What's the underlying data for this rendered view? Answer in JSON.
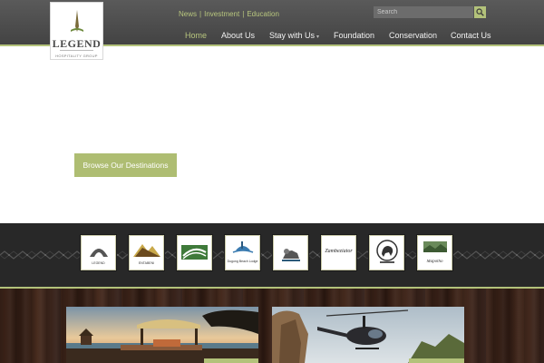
{
  "logo": {
    "brand": "LEGEND",
    "subtitle": "HOSPITALITY GROUP"
  },
  "utility_links": [
    "News",
    "Investment",
    "Education"
  ],
  "utility_separator": "|",
  "search": {
    "placeholder": "Search"
  },
  "nav": {
    "items": [
      {
        "label": "Home",
        "active": true
      },
      {
        "label": "About Us"
      },
      {
        "label": "Stay with Us",
        "dropdown": true
      },
      {
        "label": "Foundation"
      },
      {
        "label": "Conservation"
      },
      {
        "label": "Contact Us"
      }
    ],
    "dropdown_caret": "▾"
  },
  "hero": {
    "button_label": "Browse Our Destinations"
  },
  "brand_logos": [
    {
      "name": "legend-lodges",
      "caption": "LEGEND"
    },
    {
      "name": "entabeni",
      "caption": "ENTABENI"
    },
    {
      "name": "lodge-3",
      "caption": ""
    },
    {
      "name": "dugong-beach-lodge",
      "caption": "Dugong Beach Lodge"
    },
    {
      "name": "lodge-5",
      "caption": ""
    },
    {
      "name": "zambezi",
      "caption": "Zambeziator"
    },
    {
      "name": "lodge-7",
      "caption": ""
    },
    {
      "name": "mapotho",
      "caption": "Mapotho"
    }
  ],
  "colors": {
    "accent": "#b3c27a",
    "header": "#4a4a4a",
    "band": "#282828",
    "wood": "#3a2218"
  },
  "icons": {
    "search": "search-icon"
  }
}
